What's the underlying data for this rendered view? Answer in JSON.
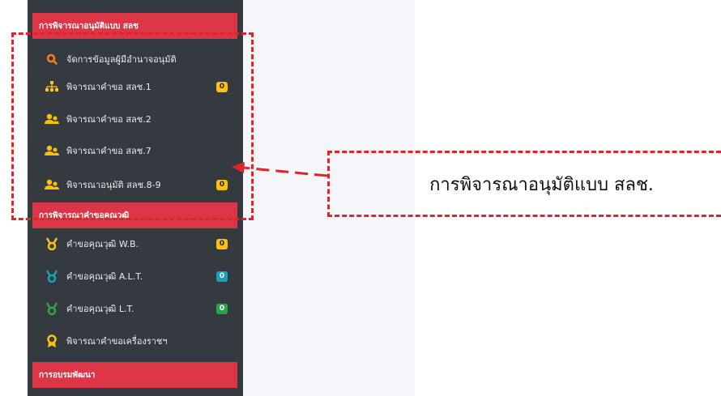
{
  "sidebar": {
    "section_approval": "การพิจารณาอนุมัติแบบ สลช",
    "section_honor": "การพิจารณาคำขอคุณวุฒิ",
    "section_training": "การอบรมพัฒนา",
    "approval_items": [
      {
        "label": "จัดการข้อมูลผู้มีอำนาจอนุมัติ",
        "icon": "search-icon",
        "icon_color": "#fd7e14",
        "badge": null
      },
      {
        "label": "พิจารณาคำขอ สลช.1",
        "icon": "sitemap-icon",
        "icon_color": "#ffc107",
        "badge": "0",
        "badge_color": "#ffc107"
      },
      {
        "label": "พิจารณาคำขอ สลช.2",
        "icon": "users-icon",
        "icon_color": "#ffc107",
        "badge": null
      },
      {
        "label": "พิจารณาคำขอ สลช.7",
        "icon": "users-icon",
        "icon_color": "#ffc107",
        "badge": null
      },
      {
        "label": "พิจารณาอนุมัติ สลช.8-9",
        "icon": "users-icon",
        "icon_color": "#ffc107",
        "badge": "0",
        "badge_color": "#ffc107"
      }
    ],
    "honor_items": [
      {
        "label": "คำขอคุณวุฒิ W.B.",
        "icon": "medal-icon",
        "icon_color": "#ffc107",
        "badge": "0",
        "badge_color": "#ffc107"
      },
      {
        "label": "คำขอคุณวุฒิ A.L.T.",
        "icon": "medal-icon",
        "icon_color": "#17a2b8",
        "badge": "0",
        "badge_color": "#17a2b8"
      },
      {
        "label": "คำขอคุณวุฒิ L.T.",
        "icon": "medal-icon",
        "icon_color": "#28a745",
        "badge": "0",
        "badge_color": "#28a745"
      },
      {
        "label": "พิจารณาคำขอเครื่องราชฯ",
        "icon": "award-icon",
        "icon_color": "#ffc107",
        "badge": null
      }
    ]
  },
  "annotation": {
    "callout_text": "การพิจารณาอนุมัติแบบ สลช.",
    "color": "#e0242b"
  }
}
